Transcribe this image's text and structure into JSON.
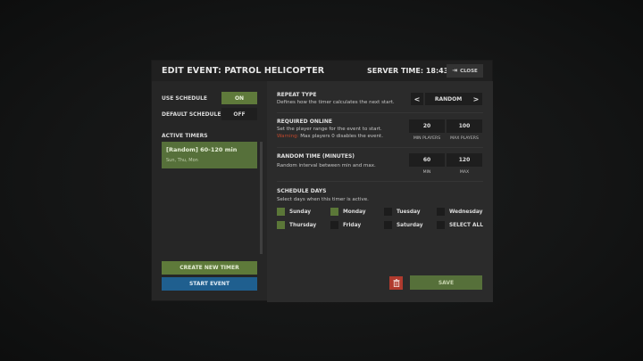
{
  "header": {
    "title": "EDIT EVENT: PATROL HELICOPTER",
    "server_time_label": "SERVER TIME:",
    "server_time": "18:43:50",
    "close_label": "CLOSE"
  },
  "left": {
    "use_schedule_label": "USE SCHEDULE",
    "use_schedule_value": "ON",
    "default_schedule_label": "DEFAULT SCHEDULE",
    "default_schedule_value": "OFF",
    "active_timers_label": "ACTIVE TIMERS",
    "timers": [
      {
        "title": "[Random] 60-120 min",
        "days": "Sun, Thu, Mon"
      }
    ],
    "create_timer_label": "CREATE NEW TIMER",
    "start_event_label": "START EVENT"
  },
  "right": {
    "repeat_type": {
      "title": "REPEAT TYPE",
      "desc": "Defines how the timer calculates the next start.",
      "prev": "<",
      "value": "RANDOM",
      "next": ">"
    },
    "required_online": {
      "title": "REQUIRED ONLINE",
      "desc": "Set the player range for the event to start.",
      "warning_word": "Warning:",
      "warning_text": "Max players 0 disables the event.",
      "min_value": "20",
      "max_value": "100",
      "min_caption": "MIN PLAYERS",
      "max_caption": "MAX PLAYERS"
    },
    "random_time": {
      "title": "RANDOM TIME (MINUTES)",
      "desc": "Random interval between min and max.",
      "min_value": "60",
      "max_value": "120",
      "min_caption": "MIN",
      "max_caption": "MAX"
    },
    "schedule_days": {
      "title": "SCHEDULE DAYS",
      "desc": "Select days when this timer is active.",
      "days": [
        {
          "label": "Sunday",
          "checked": true
        },
        {
          "label": "Monday",
          "checked": true
        },
        {
          "label": "Tuesday",
          "checked": false
        },
        {
          "label": "Wednesday",
          "checked": false
        },
        {
          "label": "Thursday",
          "checked": true
        },
        {
          "label": "Friday",
          "checked": false
        },
        {
          "label": "Saturday",
          "checked": false
        },
        {
          "label": "SELECT ALL",
          "checked": false
        }
      ]
    },
    "save_label": "SAVE"
  },
  "colors": {
    "accent_green": "#5e7a3a",
    "accent_blue": "#1f5f8f",
    "danger_red": "#b03a2e",
    "warning_text": "#c0472c"
  }
}
